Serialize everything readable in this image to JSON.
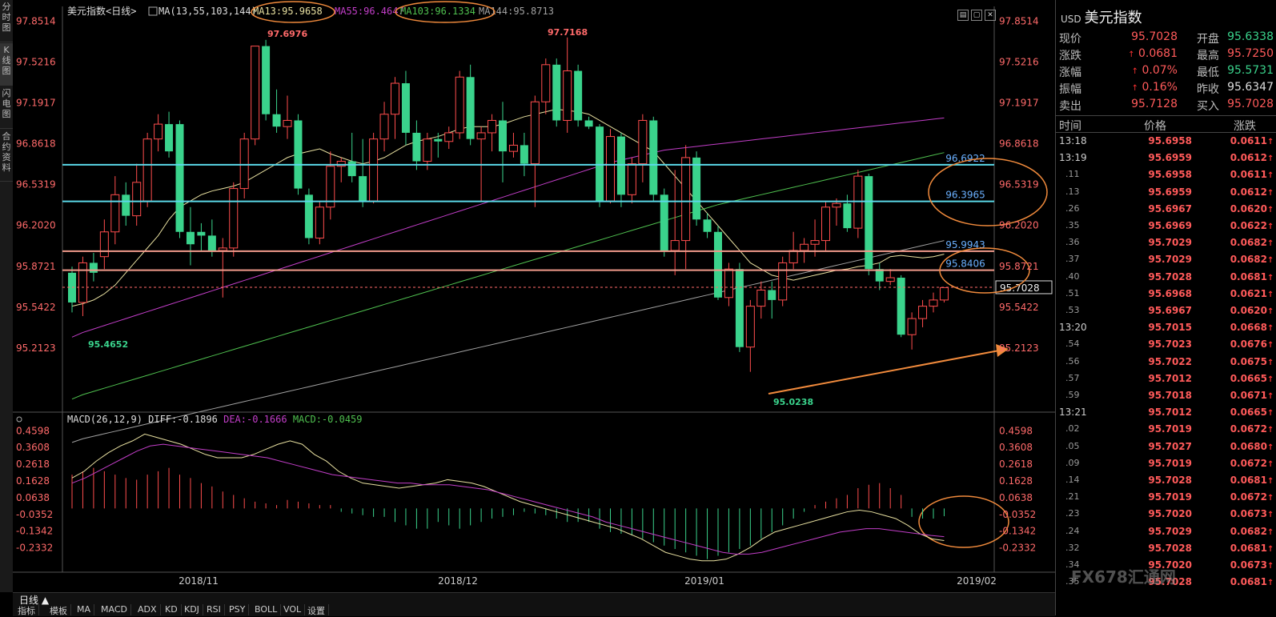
{
  "left_tabs": [
    "分时图",
    "K线图",
    "闪电图",
    "合约资料"
  ],
  "chart_header": {
    "name": "美元指数",
    "period": "<日线>",
    "ma_params": "MA(13,55,103,144)",
    "ma13": "MA13:95.9658",
    "ma55": "MA55:96.4647",
    "ma103": "MA103:96.1334",
    "ma144": "MA144:95.8713"
  },
  "macd_header": {
    "params": "MACD(26,12,9)",
    "diff": "DIFF:-0.1896",
    "dea": "DEA:-0.1666",
    "macd": "MACD:-0.0459"
  },
  "colors": {
    "up": "#ff4d4d",
    "down": "#3ad38c",
    "ma13": "#e8e0a0",
    "ma55": "#c23ec8",
    "ma103": "#4fc04f",
    "ma144": "#a0a0a0",
    "resist_blue": "#5ad8e8",
    "resist_red": "#f09a8a",
    "annot": "#f08a3c",
    "diff": "#e8e0a0",
    "dea": "#c23ec8"
  },
  "price_axis_labels": [
    "97.8514",
    "97.5216",
    "97.1917",
    "96.8618",
    "96.5319",
    "96.2020",
    "95.8721",
    "95.5422",
    "95.2123"
  ],
  "macd_axis_labels": [
    "0.4598",
    "0.3608",
    "0.2618",
    "0.1628",
    "0.0638",
    "-0.0352",
    "-0.1342",
    "-0.2332"
  ],
  "date_labels": [
    "2018/11",
    "2018/12",
    "2019/01",
    "2019/02"
  ],
  "annotations": {
    "high1": "97.6976",
    "high2": "97.7168",
    "low1": "95.4652",
    "low2": "95.0238",
    "line_a": "96.6922",
    "line_b": "96.3965",
    "line_c": "95.9943",
    "line_d": "95.8406",
    "current_price": "95.7028"
  },
  "chart_data": {
    "type": "candlestick",
    "ylim": [
      95.05,
      97.88
    ],
    "candles": [
      {
        "o": 95.82,
        "h": 95.87,
        "l": 95.5,
        "c": 95.58
      },
      {
        "o": 95.58,
        "h": 95.95,
        "l": 95.47,
        "c": 95.9
      },
      {
        "o": 95.9,
        "h": 95.98,
        "l": 95.75,
        "c": 95.82
      },
      {
        "o": 95.95,
        "h": 96.25,
        "l": 95.85,
        "c": 96.15
      },
      {
        "o": 96.15,
        "h": 96.6,
        "l": 96.05,
        "c": 96.45
      },
      {
        "o": 96.45,
        "h": 96.55,
        "l": 96.2,
        "c": 96.28
      },
      {
        "o": 96.28,
        "h": 96.7,
        "l": 96.2,
        "c": 96.55
      },
      {
        "o": 96.4,
        "h": 96.95,
        "l": 96.35,
        "c": 96.9
      },
      {
        "o": 96.9,
        "h": 97.1,
        "l": 96.8,
        "c": 97.02
      },
      {
        "o": 97.02,
        "h": 97.12,
        "l": 96.75,
        "c": 96.8
      },
      {
        "o": 97.02,
        "h": 97.05,
        "l": 96.1,
        "c": 96.15
      },
      {
        "o": 96.15,
        "h": 96.35,
        "l": 95.88,
        "c": 96.05
      },
      {
        "o": 96.15,
        "h": 96.22,
        "l": 96.0,
        "c": 96.12
      },
      {
        "o": 96.12,
        "h": 96.25,
        "l": 95.95,
        "c": 96.0
      },
      {
        "o": 96.0,
        "h": 96.1,
        "l": 95.62,
        "c": 96.02
      },
      {
        "o": 96.02,
        "h": 96.55,
        "l": 95.95,
        "c": 96.5
      },
      {
        "o": 96.5,
        "h": 96.95,
        "l": 96.42,
        "c": 96.9
      },
      {
        "o": 96.9,
        "h": 97.65,
        "l": 96.85,
        "c": 97.65
      },
      {
        "o": 97.65,
        "h": 97.7,
        "l": 97.05,
        "c": 97.1
      },
      {
        "o": 97.1,
        "h": 97.3,
        "l": 96.95,
        "c": 97.0
      },
      {
        "o": 97.0,
        "h": 97.25,
        "l": 96.9,
        "c": 97.05
      },
      {
        "o": 97.05,
        "h": 97.1,
        "l": 96.45,
        "c": 96.5
      },
      {
        "o": 96.45,
        "h": 96.5,
        "l": 96.05,
        "c": 96.1
      },
      {
        "o": 96.1,
        "h": 96.4,
        "l": 96.05,
        "c": 96.35
      },
      {
        "o": 96.35,
        "h": 96.8,
        "l": 96.25,
        "c": 96.68
      },
      {
        "o": 96.68,
        "h": 96.75,
        "l": 96.55,
        "c": 96.72
      },
      {
        "o": 96.72,
        "h": 96.95,
        "l": 96.55,
        "c": 96.6
      },
      {
        "o": 96.6,
        "h": 96.9,
        "l": 96.35,
        "c": 96.4
      },
      {
        "o": 96.4,
        "h": 96.95,
        "l": 96.38,
        "c": 96.9
      },
      {
        "o": 96.9,
        "h": 97.2,
        "l": 96.8,
        "c": 97.1
      },
      {
        "o": 97.1,
        "h": 97.4,
        "l": 96.9,
        "c": 97.35
      },
      {
        "o": 97.35,
        "h": 97.45,
        "l": 96.85,
        "c": 96.95
      },
      {
        "o": 96.95,
        "h": 97.05,
        "l": 96.65,
        "c": 96.72
      },
      {
        "o": 96.72,
        "h": 96.95,
        "l": 96.65,
        "c": 96.9
      },
      {
        "o": 96.9,
        "h": 96.95,
        "l": 96.75,
        "c": 96.88
      },
      {
        "o": 96.88,
        "h": 97.0,
        "l": 96.82,
        "c": 96.95
      },
      {
        "o": 96.95,
        "h": 97.45,
        "l": 96.9,
        "c": 97.4
      },
      {
        "o": 97.4,
        "h": 97.5,
        "l": 96.85,
        "c": 96.9
      },
      {
        "o": 96.9,
        "h": 97.0,
        "l": 96.4,
        "c": 96.95
      },
      {
        "o": 96.95,
        "h": 97.1,
        "l": 96.8,
        "c": 97.05
      },
      {
        "o": 97.05,
        "h": 97.2,
        "l": 96.55,
        "c": 96.8
      },
      {
        "o": 96.8,
        "h": 96.95,
        "l": 96.75,
        "c": 96.85
      },
      {
        "o": 96.85,
        "h": 96.95,
        "l": 96.6,
        "c": 96.7
      },
      {
        "o": 96.7,
        "h": 97.25,
        "l": 96.35,
        "c": 97.2
      },
      {
        "o": 97.2,
        "h": 97.55,
        "l": 97.1,
        "c": 97.5
      },
      {
        "o": 97.5,
        "h": 97.55,
        "l": 97.0,
        "c": 97.05
      },
      {
        "o": 97.05,
        "h": 97.72,
        "l": 96.95,
        "c": 97.45
      },
      {
        "o": 97.45,
        "h": 97.5,
        "l": 97.0,
        "c": 97.05
      },
      {
        "o": 97.05,
        "h": 97.08,
        "l": 96.98,
        "c": 97.0
      },
      {
        "o": 97.0,
        "h": 97.02,
        "l": 96.35,
        "c": 96.4
      },
      {
        "o": 96.4,
        "h": 96.98,
        "l": 96.38,
        "c": 96.92
      },
      {
        "o": 96.92,
        "h": 96.95,
        "l": 96.35,
        "c": 96.45
      },
      {
        "o": 96.45,
        "h": 96.75,
        "l": 96.38,
        "c": 96.7
      },
      {
        "o": 96.7,
        "h": 97.1,
        "l": 96.55,
        "c": 97.05
      },
      {
        "o": 97.05,
        "h": 97.08,
        "l": 96.4,
        "c": 96.45
      },
      {
        "o": 96.45,
        "h": 96.5,
        "l": 95.95,
        "c": 96.0
      },
      {
        "o": 96.0,
        "h": 96.65,
        "l": 95.8,
        "c": 96.08
      },
      {
        "o": 96.08,
        "h": 96.85,
        "l": 95.85,
        "c": 96.75
      },
      {
        "o": 96.75,
        "h": 96.8,
        "l": 96.2,
        "c": 96.25
      },
      {
        "o": 96.25,
        "h": 96.3,
        "l": 96.1,
        "c": 96.15
      },
      {
        "o": 96.15,
        "h": 96.2,
        "l": 95.6,
        "c": 95.62
      },
      {
        "o": 95.62,
        "h": 95.9,
        "l": 95.55,
        "c": 95.85
      },
      {
        "o": 95.85,
        "h": 95.9,
        "l": 95.18,
        "c": 95.22
      },
      {
        "o": 95.22,
        "h": 95.6,
        "l": 95.02,
        "c": 95.55
      },
      {
        "o": 95.55,
        "h": 95.75,
        "l": 95.45,
        "c": 95.68
      },
      {
        "o": 95.68,
        "h": 95.75,
        "l": 95.45,
        "c": 95.6
      },
      {
        "o": 95.6,
        "h": 95.95,
        "l": 95.55,
        "c": 95.9
      },
      {
        "o": 95.9,
        "h": 96.15,
        "l": 95.85,
        "c": 96.0
      },
      {
        "o": 96.0,
        "h": 96.1,
        "l": 95.9,
        "c": 96.05
      },
      {
        "o": 96.05,
        "h": 96.25,
        "l": 95.95,
        "c": 96.08
      },
      {
        "o": 96.08,
        "h": 96.4,
        "l": 96.0,
        "c": 96.35
      },
      {
        "o": 96.35,
        "h": 96.42,
        "l": 96.2,
        "c": 96.38
      },
      {
        "o": 96.38,
        "h": 96.45,
        "l": 96.15,
        "c": 96.18
      },
      {
        "o": 96.18,
        "h": 96.65,
        "l": 96.1,
        "c": 96.6
      },
      {
        "o": 96.6,
        "h": 96.62,
        "l": 95.8,
        "c": 95.85
      },
      {
        "o": 95.85,
        "h": 95.9,
        "l": 95.68,
        "c": 95.75
      },
      {
        "o": 95.75,
        "h": 95.85,
        "l": 95.72,
        "c": 95.78
      },
      {
        "o": 95.78,
        "h": 95.8,
        "l": 95.3,
        "c": 95.32
      },
      {
        "o": 95.32,
        "h": 95.5,
        "l": 95.2,
        "c": 95.45
      },
      {
        "o": 95.45,
        "h": 95.6,
        "l": 95.38,
        "c": 95.55
      },
      {
        "o": 95.55,
        "h": 95.66,
        "l": 95.5,
        "c": 95.6
      },
      {
        "o": 95.6,
        "h": 95.7,
        "l": 95.58,
        "c": 95.7
      }
    ],
    "ma13": [
      95.55,
      95.57,
      95.6,
      95.65,
      95.72,
      95.82,
      95.92,
      96.02,
      96.12,
      96.25,
      96.35,
      96.4,
      96.45,
      96.48,
      96.5,
      96.52,
      96.55,
      96.6,
      96.65,
      96.7,
      96.75,
      96.78,
      96.8,
      96.82,
      96.78,
      96.75,
      96.72,
      96.7,
      96.72,
      96.75,
      96.8,
      96.85,
      96.88,
      96.9,
      96.92,
      96.95,
      96.98,
      97.0,
      97.0,
      97.0,
      97.02,
      97.05,
      97.08,
      97.1,
      97.12,
      97.14,
      97.13,
      97.12,
      97.1,
      97.05,
      97.0,
      96.95,
      96.9,
      96.85,
      96.8,
      96.7,
      96.6,
      96.5,
      96.4,
      96.3,
      96.2,
      96.1,
      96.0,
      95.9,
      95.85,
      95.8,
      95.78,
      95.76,
      95.78,
      95.8,
      95.82,
      95.84,
      95.85,
      95.87,
      95.88,
      95.9,
      95.95,
      95.96,
      95.95,
      95.94,
      95.95,
      95.97
    ],
    "ma144": [
      95.05,
      95.08,
      95.1,
      95.12,
      95.14,
      95.16,
      95.18,
      95.2,
      95.22,
      95.24,
      95.26,
      95.28,
      95.3,
      95.32,
      95.34,
      95.36,
      95.38,
      95.4,
      95.42,
      95.44,
      95.46,
      95.48,
      95.5,
      95.52,
      95.54,
      95.56,
      95.58,
      95.6,
      95.62,
      95.64,
      95.66,
      95.68,
      95.7,
      95.72,
      95.74,
      95.76,
      95.78,
      95.8,
      95.82,
      95.84,
      95.86,
      95.88,
      95.9,
      95.92,
      95.94,
      95.96,
      95.98,
      96.0,
      96.02,
      96.04,
      96.06,
      96.08,
      96.1,
      96.12,
      96.14,
      96.16,
      96.18,
      96.2,
      96.22,
      96.24,
      96.26,
      96.28,
      96.3,
      96.32,
      96.34,
      96.36,
      96.38,
      96.4,
      96.42,
      96.44,
      96.46,
      96.48,
      96.5,
      96.52,
      96.54,
      96.56,
      96.58,
      96.6,
      96.62,
      96.64,
      96.66,
      96.68
    ]
  },
  "macd_data": {
    "hist": [
      0.2,
      0.22,
      0.24,
      0.22,
      0.2,
      0.18,
      0.17,
      0.2,
      0.22,
      0.24,
      0.2,
      0.18,
      0.15,
      0.13,
      0.1,
      0.08,
      0.06,
      0.04,
      0.03,
      0.02,
      0.05,
      0.04,
      0.03,
      0.02,
      0.02,
      -0.02,
      -0.03,
      -0.04,
      -0.05,
      -0.05,
      -0.08,
      -0.1,
      -0.12,
      -0.12,
      -0.08,
      -0.1,
      -0.12,
      -0.1,
      -0.08,
      -0.06,
      -0.05,
      -0.04,
      -0.02,
      -0.03,
      -0.04,
      -0.06,
      -0.08,
      -0.08,
      -0.08,
      -0.12,
      -0.14,
      -0.15,
      -0.16,
      -0.18,
      -0.2,
      -0.22,
      -0.24,
      -0.26,
      -0.28,
      -0.3,
      -0.28,
      -0.26,
      -0.24,
      -0.22,
      -0.18,
      -0.14,
      -0.1,
      -0.06,
      -0.02,
      0.02,
      0.04,
      0.06,
      0.08,
      0.12,
      0.14,
      0.15,
      0.12,
      0.08,
      -0.05,
      -0.06,
      -0.06,
      -0.046
    ],
    "diff": [
      0.18,
      0.22,
      0.28,
      0.33,
      0.37,
      0.4,
      0.44,
      0.42,
      0.4,
      0.38,
      0.35,
      0.32,
      0.3,
      0.3,
      0.3,
      0.32,
      0.35,
      0.38,
      0.4,
      0.38,
      0.32,
      0.28,
      0.22,
      0.18,
      0.15,
      0.14,
      0.13,
      0.12,
      0.13,
      0.14,
      0.15,
      0.17,
      0.16,
      0.15,
      0.13,
      0.1,
      0.07,
      0.04,
      0.02,
      0.0,
      -0.02,
      -0.04,
      -0.06,
      -0.08,
      -0.1,
      -0.12,
      -0.15,
      -0.18,
      -0.22,
      -0.26,
      -0.28,
      -0.3,
      -0.31,
      -0.31,
      -0.3,
      -0.27,
      -0.23,
      -0.18,
      -0.14,
      -0.12,
      -0.1,
      -0.08,
      -0.06,
      -0.04,
      -0.02,
      -0.01,
      -0.02,
      -0.04,
      -0.06,
      -0.1,
      -0.15,
      -0.18,
      -0.19
    ],
    "dea": [
      0.15,
      0.18,
      0.22,
      0.26,
      0.3,
      0.34,
      0.37,
      0.38,
      0.37,
      0.36,
      0.35,
      0.34,
      0.33,
      0.32,
      0.31,
      0.3,
      0.28,
      0.26,
      0.24,
      0.22,
      0.2,
      0.19,
      0.18,
      0.17,
      0.16,
      0.15,
      0.15,
      0.14,
      0.14,
      0.14,
      0.13,
      0.12,
      0.11,
      0.09,
      0.07,
      0.05,
      0.03,
      0.01,
      -0.01,
      -0.03,
      -0.05,
      -0.08,
      -0.1,
      -0.12,
      -0.14,
      -0.16,
      -0.18,
      -0.2,
      -0.22,
      -0.24,
      -0.26,
      -0.27,
      -0.27,
      -0.26,
      -0.24,
      -0.22,
      -0.2,
      -0.18,
      -0.16,
      -0.14,
      -0.13,
      -0.12,
      -0.12,
      -0.13,
      -0.14,
      -0.15,
      -0.16,
      -0.167
    ],
    "ylim": [
      -0.33,
      0.48
    ]
  },
  "quote": {
    "symbol": "USD",
    "title": "美元指数",
    "rows": [
      {
        "l1": "现价",
        "v1": "95.7028",
        "l2": "开盘",
        "v2": "95.6338",
        "c2": "#3ad38c",
        "a1": ""
      },
      {
        "l1": "涨跌",
        "v1": "0.0681",
        "l2": "最高",
        "v2": "95.7250",
        "c2": "#ff5a5a",
        "a1": "↑"
      },
      {
        "l1": "涨幅",
        "v1": "0.07%",
        "l2": "最低",
        "v2": "95.5731",
        "c2": "#3ad38c",
        "a1": "↑"
      },
      {
        "l1": "振幅",
        "v1": "0.16%",
        "l2": "昨收",
        "v2": "95.6347",
        "c2": "#dddddd",
        "a1": "↑"
      },
      {
        "l1": "卖出",
        "v1": "95.7128",
        "l2": "买入",
        "v2": "95.7028",
        "c2": "#ff5a5a",
        "a1": ""
      }
    ]
  },
  "ticks_header": {
    "time": "时间",
    "price": "价格",
    "change": "涨跌"
  },
  "ticks": [
    {
      "t": "13:18",
      "big": true,
      "p": "95.6958",
      "c": "0.0611"
    },
    {
      "t": "13:19",
      "big": true,
      "p": "95.6959",
      "c": "0.0612"
    },
    {
      "t": ".11",
      "big": false,
      "p": "95.6958",
      "c": "0.0611"
    },
    {
      "t": ".13",
      "big": false,
      "p": "95.6959",
      "c": "0.0612"
    },
    {
      "t": ".26",
      "big": false,
      "p": "95.6967",
      "c": "0.0620"
    },
    {
      "t": ".35",
      "big": false,
      "p": "95.6969",
      "c": "0.0622"
    },
    {
      "t": ".36",
      "big": false,
      "p": "95.7029",
      "c": "0.0682"
    },
    {
      "t": ".37",
      "big": false,
      "p": "95.7029",
      "c": "0.0682"
    },
    {
      "t": ".40",
      "big": false,
      "p": "95.7028",
      "c": "0.0681"
    },
    {
      "t": ".51",
      "big": false,
      "p": "95.6968",
      "c": "0.0621"
    },
    {
      "t": ".53",
      "big": false,
      "p": "95.6967",
      "c": "0.0620"
    },
    {
      "t": "13:20",
      "big": true,
      "p": "95.7015",
      "c": "0.0668"
    },
    {
      "t": ".54",
      "big": false,
      "p": "95.7023",
      "c": "0.0676"
    },
    {
      "t": ".56",
      "big": false,
      "p": "95.7022",
      "c": "0.0675"
    },
    {
      "t": ".57",
      "big": false,
      "p": "95.7012",
      "c": "0.0665"
    },
    {
      "t": ".59",
      "big": false,
      "p": "95.7018",
      "c": "0.0671"
    },
    {
      "t": "13:21",
      "big": true,
      "p": "95.7012",
      "c": "0.0665"
    },
    {
      "t": ".02",
      "big": false,
      "p": "95.7019",
      "c": "0.0672"
    },
    {
      "t": ".05",
      "big": false,
      "p": "95.7027",
      "c": "0.0680"
    },
    {
      "t": ".09",
      "big": false,
      "p": "95.7019",
      "c": "0.0672"
    },
    {
      "t": ".14",
      "big": false,
      "p": "95.7028",
      "c": "0.0681"
    },
    {
      "t": ".21",
      "big": false,
      "p": "95.7019",
      "c": "0.0672"
    },
    {
      "t": ".23",
      "big": false,
      "p": "95.7020",
      "c": "0.0673"
    },
    {
      "t": ".24",
      "big": false,
      "p": "95.7029",
      "c": "0.0682"
    },
    {
      "t": ".32",
      "big": false,
      "p": "95.7028",
      "c": "0.0681"
    },
    {
      "t": ".34",
      "big": false,
      "p": "95.7020",
      "c": "0.0673"
    },
    {
      "t": ".35",
      "big": false,
      "p": "95.7028",
      "c": "0.0681"
    }
  ],
  "bottom_tabs": [
    "日线 ▲",
    "指标",
    "模板",
    "MA",
    "MACD",
    "ADX",
    "KD",
    "KDJ",
    "RSI",
    "PSY",
    "BOLL",
    "VOL",
    "设置"
  ],
  "watermark": "FX678汇通网"
}
